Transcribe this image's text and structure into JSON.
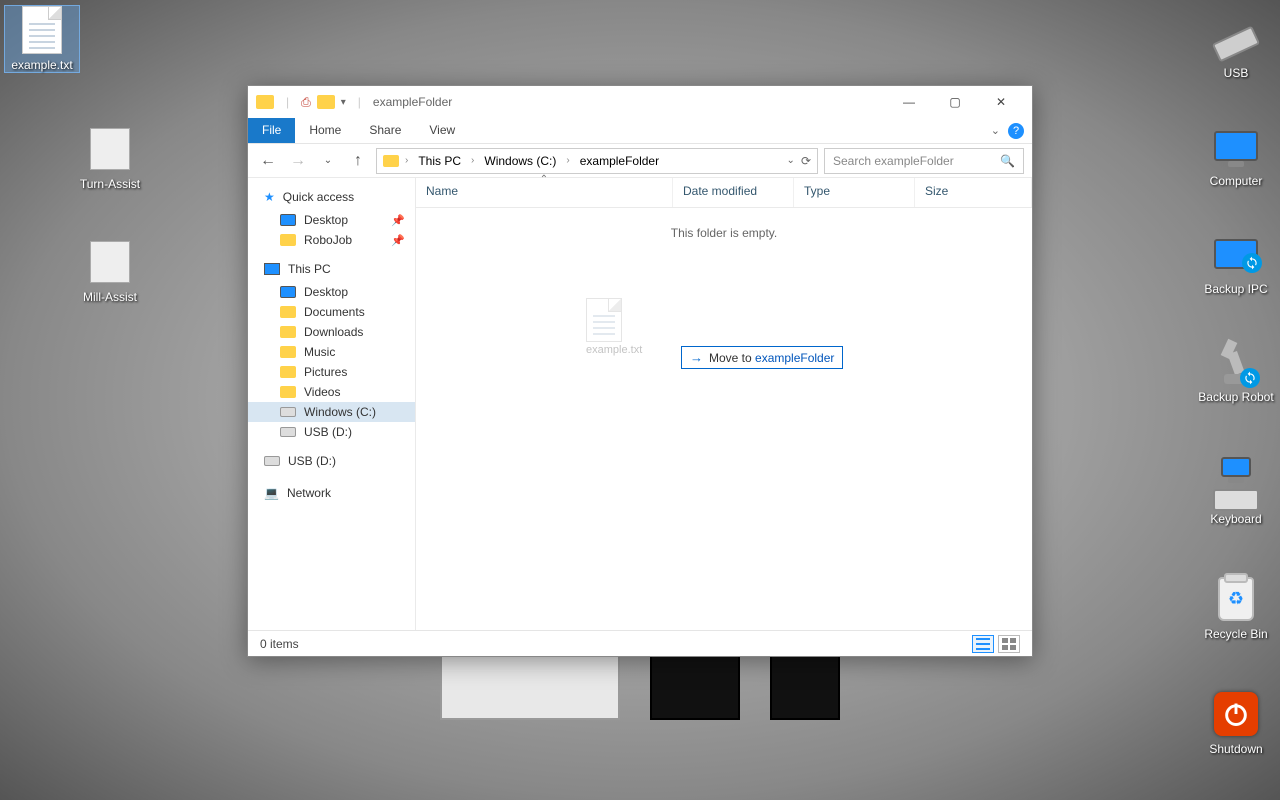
{
  "desktop": {
    "left": [
      {
        "name": "example-txt",
        "label": "example.txt",
        "selected": true
      },
      {
        "name": "turn-assist",
        "label": "Turn-Assist"
      },
      {
        "name": "mill-assist",
        "label": "Mill-Assist"
      }
    ],
    "right": [
      {
        "name": "usb",
        "label": "USB"
      },
      {
        "name": "computer",
        "label": "Computer"
      },
      {
        "name": "backup-ipc",
        "label": "Backup IPC"
      },
      {
        "name": "backup-robot",
        "label": "Backup Robot"
      },
      {
        "name": "keyboard",
        "label": "Keyboard"
      },
      {
        "name": "recycle-bin",
        "label": "Recycle Bin"
      },
      {
        "name": "shutdown",
        "label": "Shutdown"
      }
    ]
  },
  "window": {
    "title": "exampleFolder",
    "tabs": {
      "file": "File",
      "home": "Home",
      "share": "Share",
      "view": "View"
    },
    "breadcrumb": [
      "This PC",
      "Windows (C:)",
      "exampleFolder"
    ],
    "search_placeholder": "Search exampleFolder",
    "columns": {
      "name": "Name",
      "date": "Date modified",
      "type": "Type",
      "size": "Size"
    },
    "empty_message": "This folder is empty.",
    "drag": {
      "ghost_label": "example.txt",
      "tip_prefix": "Move to ",
      "tip_dest": "exampleFolder"
    },
    "status": "0 items",
    "nav": {
      "quick_access": "Quick access",
      "quick_items": [
        {
          "label": "Desktop",
          "pinned": true,
          "icon": "desktop"
        },
        {
          "label": "RoboJob",
          "pinned": true,
          "icon": "folder"
        }
      ],
      "this_pc": "This PC",
      "pc_items": [
        {
          "label": "Desktop",
          "icon": "desktop"
        },
        {
          "label": "Documents",
          "icon": "folder"
        },
        {
          "label": "Downloads",
          "icon": "folder"
        },
        {
          "label": "Music",
          "icon": "folder"
        },
        {
          "label": "Pictures",
          "icon": "folder"
        },
        {
          "label": "Videos",
          "icon": "folder"
        },
        {
          "label": "Windows (C:)",
          "icon": "disk",
          "selected": true
        },
        {
          "label": "USB (D:)",
          "icon": "disk"
        }
      ],
      "usb": "USB (D:)",
      "network": "Network"
    }
  }
}
